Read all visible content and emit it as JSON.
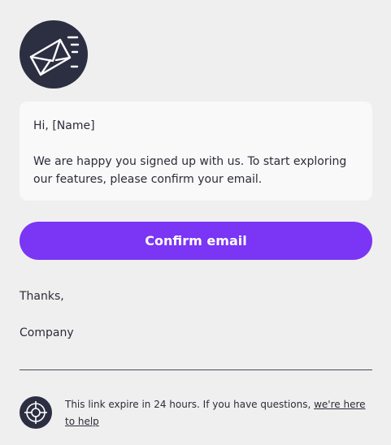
{
  "header": {
    "logo_icon": "envelope-send-icon"
  },
  "message": {
    "greeting": "Hi, [Name]",
    "body": "We are happy you signed up with us. To start exploring our features, please confirm your email."
  },
  "action": {
    "confirm_label": "Confirm email",
    "button_color": "#7b35f5"
  },
  "signoff": {
    "thanks": "Thanks,",
    "company": "Company"
  },
  "footer": {
    "icon": "lifebuoy-icon",
    "text": "This link expire in 24 hours. If you have questions, ",
    "help_link": "we're here to help"
  },
  "colors": {
    "background": "#efefef",
    "card": "#f9f9f9",
    "dark": "#2c2f42",
    "accent": "#7b35f5"
  }
}
